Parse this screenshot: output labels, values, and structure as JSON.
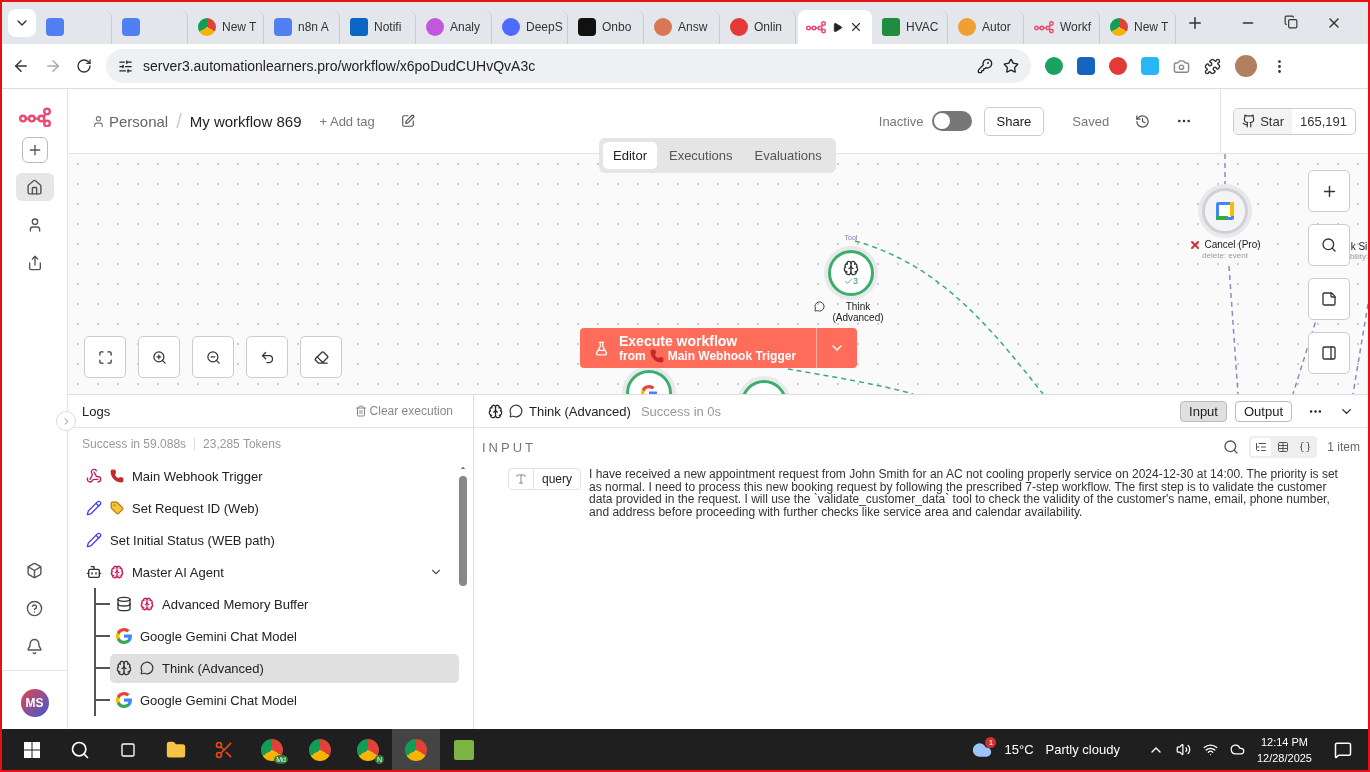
{
  "browser": {
    "tabs": [
      {
        "selected": false
      },
      {
        "selected": false
      },
      {
        "title": "New T",
        "selected": false
      },
      {
        "title": "n8n A",
        "selected": false
      },
      {
        "title": "Notifi",
        "selected": false
      },
      {
        "title": "Analy",
        "selected": false
      },
      {
        "title": "DeepS",
        "selected": false
      },
      {
        "title": "Onbo",
        "selected": false
      },
      {
        "title": "Answ",
        "selected": false
      },
      {
        "title": "Onlin",
        "selected": false
      },
      {
        "selected": true,
        "playing": true
      },
      {
        "title": "HVAC",
        "selected": false
      },
      {
        "title": "Autor",
        "selected": false
      },
      {
        "title": "Workf",
        "selected": false
      },
      {
        "title": "New T",
        "selected": false
      }
    ],
    "url": "server3.automationlearners.pro/workflow/x6poDudCUHvQvA3c"
  },
  "header": {
    "project": "Personal",
    "separator": "/",
    "workflow_name": "My workflow 869",
    "add_tag": "+ Add tag",
    "active": false,
    "active_label": "Inactive",
    "share": "Share",
    "save_state": "Saved",
    "star": "Star",
    "star_count": "165,191"
  },
  "view_tabs": [
    {
      "label": "Editor",
      "selected": true
    },
    {
      "label": "Executions",
      "selected": false
    },
    {
      "label": "Evaluations",
      "selected": false
    }
  ],
  "canvas": {
    "nodes": [
      {
        "kind": "think",
        "label": "Think (Advanced)",
        "executed": true,
        "runs": "3",
        "port": "Tool"
      },
      {
        "kind": "calendar",
        "label": "Cancel (Pro)",
        "subtitle": "delete: event",
        "executed": false,
        "error": true
      },
      {
        "label": "k Si",
        "subtitle": "bility:"
      },
      {
        "kind": "google",
        "executed": true
      },
      {
        "kind": "memory",
        "executed": true
      }
    ],
    "execute": {
      "title": "Execute workflow",
      "from": "from",
      "trigger": "Main Webhook Trigger"
    }
  },
  "logs": {
    "title": "Logs",
    "clear": "Clear execution",
    "summary": "Success in 59.088s",
    "tokens": "23,285 Tokens",
    "items": [
      {
        "kind": "webhook",
        "label": "Main Webhook Trigger",
        "selected": false
      },
      {
        "kind": "set",
        "label": "Set Request ID (Web)",
        "selected": false
      },
      {
        "kind": "set",
        "label": "Set Initial Status (WEB path)",
        "selected": false
      },
      {
        "kind": "agent",
        "label": "Master AI Agent",
        "selected": false,
        "expanded": true,
        "children": [
          {
            "kind": "memory",
            "label": "Advanced Memory Buffer",
            "selected": false
          },
          {
            "kind": "google",
            "label": "Google Gemini Chat Model",
            "selected": false
          },
          {
            "kind": "think",
            "label": "Think (Advanced)",
            "selected": true
          },
          {
            "kind": "google",
            "label": "Google Gemini Chat Model",
            "selected": false
          }
        ]
      }
    ]
  },
  "detail": {
    "node": "Think (Advanced)",
    "status": "Success in 0s",
    "modes": [
      {
        "label": "Input",
        "selected": true
      },
      {
        "label": "Output",
        "selected": false
      }
    ],
    "section": "INPUT",
    "count": "1 item",
    "views": [
      {
        "kind": "schema",
        "selected": true
      },
      {
        "kind": "table",
        "selected": false
      },
      {
        "kind": "json",
        "selected": false
      }
    ],
    "field": {
      "name": "query",
      "value": "I have received a new appointment request from John Smith for an AC not cooling properly service on 2024-12-30 at 14:00. The priority is set as normal. I need to process this new booking request by following the prescribed 7-step workflow. The first step is to validate the customer data provided in the request. I will use the `validate_customer_data` tool to check the validity of the customer's name, email, phone number, and address before proceeding with further checks like service area and calendar availability."
    }
  },
  "user": {
    "initials": "MS"
  },
  "taskbar": {
    "apps": [
      {
        "selected": false
      },
      {
        "selected": false
      },
      {
        "badge": "Md",
        "selected": false
      },
      {
        "selected": false
      },
      {
        "badge": "N",
        "selected": false
      },
      {
        "selected": true
      },
      {
        "selected": false
      }
    ],
    "weather_badge": "1",
    "temperature": "15°C",
    "weather": "Partly cloudy",
    "time": "12:14 PM",
    "date": "12/28/2025"
  }
}
